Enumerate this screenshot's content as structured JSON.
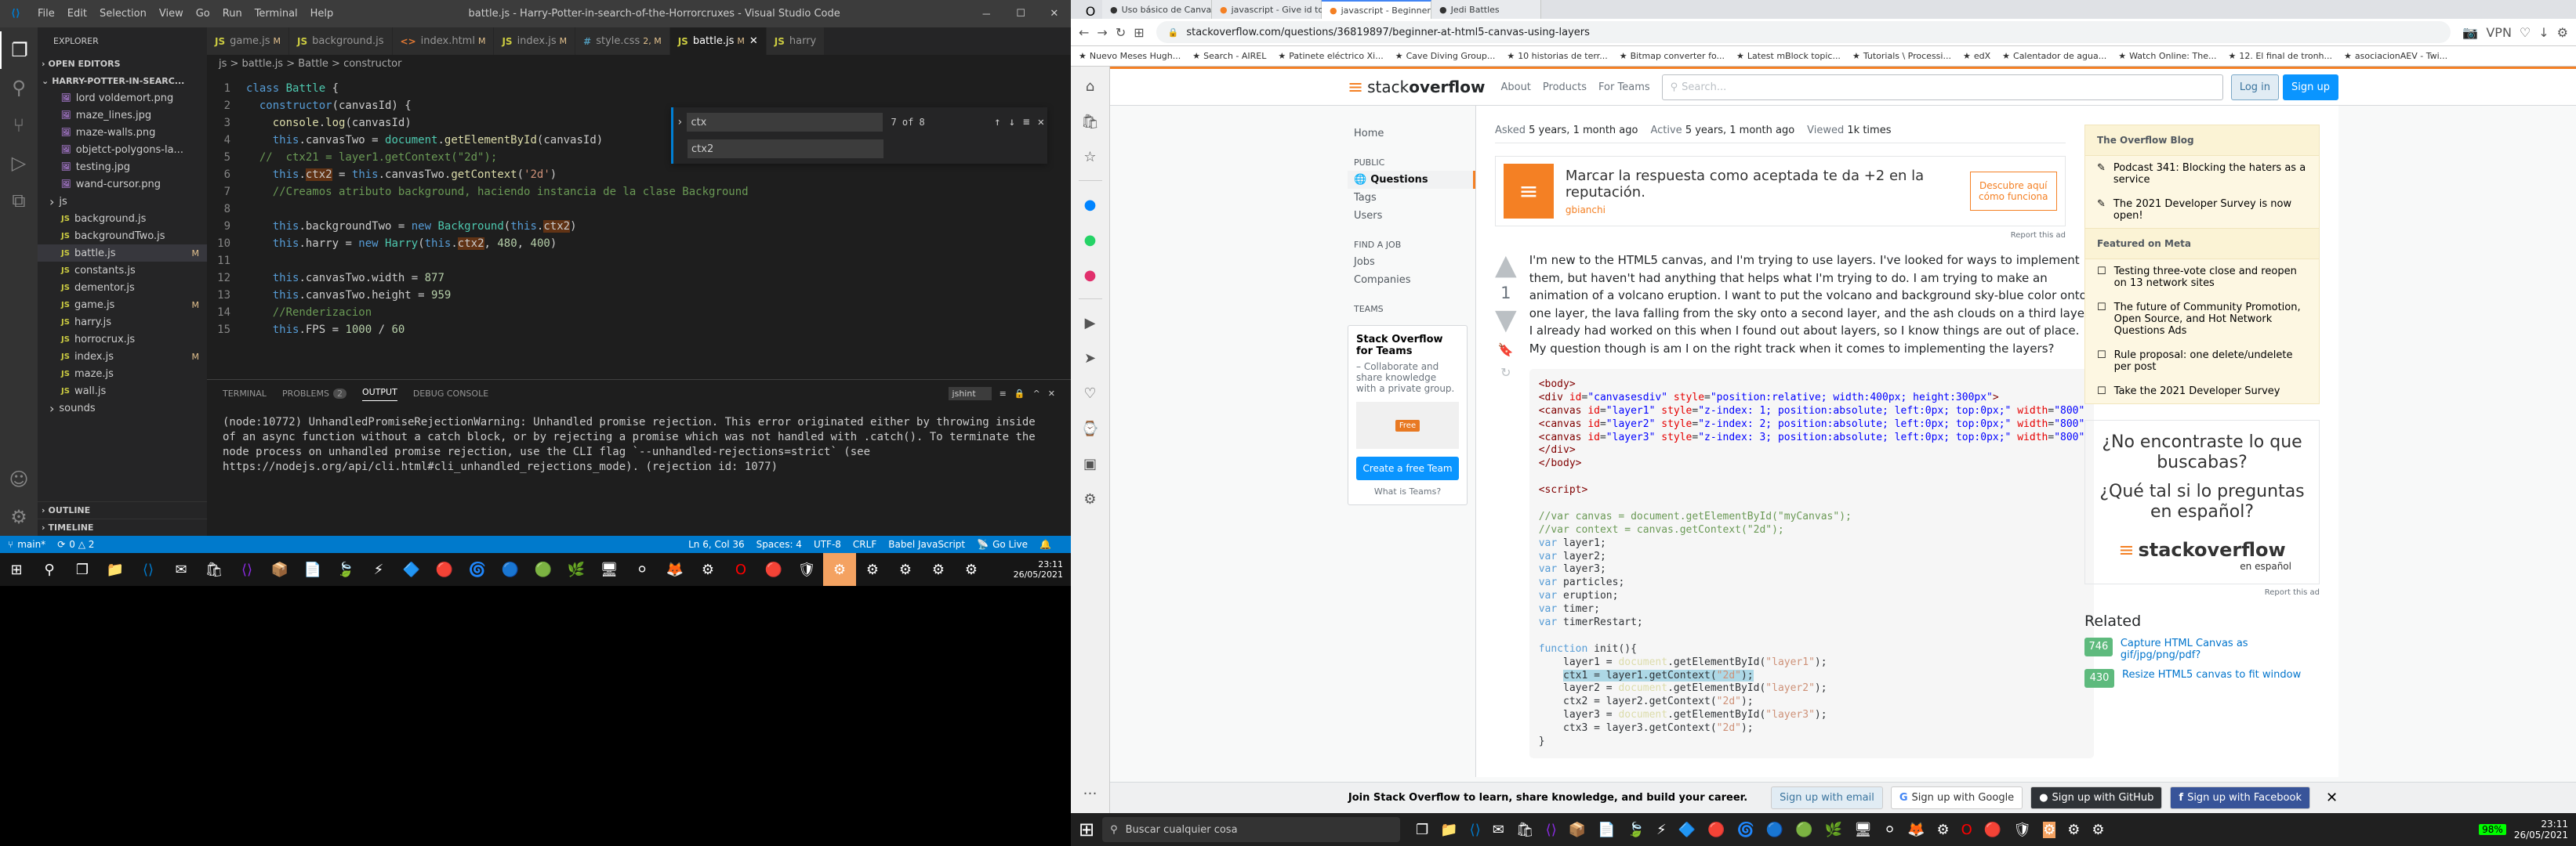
{
  "vscode": {
    "title": "battle.js - Harry-Potter-in-search-of-the-Horrorcruxes - Visual Studio Code",
    "menu": [
      "File",
      "Edit",
      "Selection",
      "View",
      "Go",
      "Run",
      "Terminal",
      "Help"
    ],
    "sidebar": {
      "explorer_label": "EXPLORER",
      "open_editors": "OPEN EDITORS",
      "project_name": "HARRY-POTTER-IN-SEARC...",
      "files": [
        {
          "name": "lord voldemort.png",
          "indent": 2
        },
        {
          "name": "maze_lines.jpg",
          "indent": 2
        },
        {
          "name": "maze-walls.png",
          "indent": 2
        },
        {
          "name": "objetct-polygons-la...",
          "indent": 2
        },
        {
          "name": "testing.jpg",
          "indent": 2
        },
        {
          "name": "wand-cursor.png",
          "indent": 2
        },
        {
          "name": "js",
          "is_folder": true,
          "indent": 1
        },
        {
          "name": "background.js",
          "indent": 2
        },
        {
          "name": "backgroundTwo.js",
          "indent": 2
        },
        {
          "name": "battle.js",
          "status": "M",
          "active": true,
          "indent": 2
        },
        {
          "name": "constants.js",
          "indent": 2
        },
        {
          "name": "dementor.js",
          "indent": 2
        },
        {
          "name": "game.js",
          "status": "M",
          "indent": 2
        },
        {
          "name": "harry.js",
          "indent": 2
        },
        {
          "name": "horrocrux.js",
          "indent": 2
        },
        {
          "name": "index.js",
          "status": "M",
          "indent": 2
        },
        {
          "name": "maze.js",
          "indent": 2
        },
        {
          "name": "wall.js",
          "indent": 2
        },
        {
          "name": "sounds",
          "is_folder": true,
          "indent": 1
        }
      ],
      "outline": "OUTLINE",
      "timeline": "TIMELINE"
    },
    "tabs": [
      {
        "name": "game.js",
        "status": "M",
        "icon": "JS"
      },
      {
        "name": "background.js",
        "icon": "JS"
      },
      {
        "name": "index.html",
        "status": "M",
        "icon": "<>"
      },
      {
        "name": "index.js",
        "status": "M",
        "icon": "JS"
      },
      {
        "name": "style.css",
        "status": "2, M",
        "icon": "#"
      },
      {
        "name": "battle.js",
        "status": "M",
        "active": true,
        "icon": "JS"
      },
      {
        "name": "harry",
        "icon": "JS"
      }
    ],
    "breadcrumbs": "js > battle.js > Battle > constructor",
    "find_widget": {
      "search": "ctx",
      "replace": "ctx2",
      "count": "7 of 8"
    },
    "code_lines": [
      {
        "num": 1,
        "content": "class Battle {"
      },
      {
        "num": 2,
        "content": "  constructor(canvasId) {"
      },
      {
        "num": 3,
        "content": "    console.log(canvasId)"
      },
      {
        "num": 4,
        "content": "    this.canvasTwo = document.getElementById(canvasId)"
      },
      {
        "num": 5,
        "content": "  //  ctx21 = layer1.getContext(\"2d\");"
      },
      {
        "num": 6,
        "content": "    this.ctx2 = this.canvasTwo.getContext('2d')"
      },
      {
        "num": 7,
        "content": "    //Creamos atributo background, haciendo instancia de la clase Background"
      },
      {
        "num": 8,
        "content": ""
      },
      {
        "num": 9,
        "content": "    this.backgroundTwo = new Background(this.ctx2)"
      },
      {
        "num": 10,
        "content": "    this.harry = new Harry(this.ctx2, 480, 400)"
      },
      {
        "num": 11,
        "content": ""
      },
      {
        "num": 12,
        "content": "    this.canvasTwo.width = 877"
      },
      {
        "num": 13,
        "content": "    this.canvasTwo.height = 959"
      },
      {
        "num": 14,
        "content": "    //Renderizacion"
      },
      {
        "num": 15,
        "content": "    this.FPS = 1000 / 60"
      }
    ],
    "panel": {
      "tabs": [
        "TERMINAL",
        "PROBLEMS",
        "OUTPUT",
        "DEBUG CONSOLE"
      ],
      "problems_count": "2",
      "active_tab": "OUTPUT",
      "dropdown": "jshint",
      "content": "(node:10772) UnhandledPromiseRejectionWarning: Unhandled promise rejection. This error originated either by throwing inside of an async function without a catch block, or by rejecting a promise which was not handled with .catch(). To terminate the node process on unhandled promise rejection, use the CLI flag `--unhandled-rejections=strict` (see https://nodejs.org/api/cli.html#cli_unhandled_rejections_mode). (rejection id: 1077)"
    },
    "statusbar": {
      "branch": "main*",
      "sync": "0 △ 2",
      "position": "Ln 6, Col 36",
      "spaces": "Spaces: 4",
      "encoding": "UTF-8",
      "eol": "CRLF",
      "lang": "Babel JavaScript",
      "live": "Go Live"
    },
    "time": "23:11",
    "date": "26/05/2021"
  },
  "browser": {
    "tabs": [
      {
        "title": "Uso básico de Canvas - Re"
      },
      {
        "title": "javascript - Give id to a ca"
      },
      {
        "title": "javascript - Beginner at HT",
        "active": true
      },
      {
        "title": "Jedi Battles"
      }
    ],
    "url": "stackoverflow.com/questions/36819897/beginner-at-html5-canvas-using-layers",
    "bookmarks": [
      "Nuevo Meses Hugh...",
      "Search - AIREL",
      "Patinete eléctrico Xi...",
      "Cave Diving Group...",
      "10 historias de terr...",
      "Bitmap converter fo...",
      "Latest mBlock topic...",
      "Tutorials \\ Processi...",
      "edX",
      "Calentador de agua...",
      "Watch Online: The...",
      "12. El final de tronh...",
      "asociacionAEV - Twi..."
    ],
    "so": {
      "nav": [
        "About",
        "Products",
        "For Teams"
      ],
      "search_placeholder": "Search...",
      "login": "Log in",
      "signup": "Sign up",
      "left_nav": [
        {
          "label": "Home"
        },
        {
          "label": "PUBLIC",
          "header": true
        },
        {
          "label": "Questions",
          "active": true
        },
        {
          "label": "Tags"
        },
        {
          "label": "Users"
        },
        {
          "label": "FIND A JOB",
          "header": true
        },
        {
          "label": "Jobs"
        },
        {
          "label": "Companies"
        },
        {
          "label": "TEAMS",
          "header": true
        }
      ],
      "teams_promo": {
        "title": "Stack Overflow for Teams",
        "text": "– Collaborate and share knowledge with a private group.",
        "btn": "Create a free Team",
        "link": "What is Teams?"
      },
      "question": {
        "asked": "5 years, 1 month ago",
        "active": "5 years, 1 month ago",
        "viewed": "1k times",
        "votes": "1",
        "body": "I'm new to the HTML5 canvas, and I'm trying to use layers. I've looked for ways to implement them, but haven't had anything that helps what I'm trying to do. I am trying to make an animation of a volcano eruption. I want to put the volcano and background sky-blue color onto one layer, the lava falling from the sky onto a second layer, and the ash clouds on a third layer. I already had worked on this when I found out about layers, so I know things are out of place. My question though is am I on the right track when it comes to implementing the layers?",
        "ad": {
          "text": "Marcar la respuesta como aceptada te da +2 en la reputación.",
          "btn": "Descubre aquí cómo funciona",
          "user": "gbianchi",
          "report": "Report this ad"
        }
      },
      "sidebar": {
        "blog_title": "The Overflow Blog",
        "blog_items": [
          "Podcast 341: Blocking the haters as a service",
          "The 2021 Developer Survey is now open!"
        ],
        "meta_title": "Featured on Meta",
        "meta_items": [
          "Testing three-vote close and reopen on 13 network sites",
          "The future of Community Promotion, Open Source, and Hot Network Questions Ads",
          "Rule proposal: one delete/undelete per post",
          "Take the 2021 Developer Survey"
        ],
        "ad": {
          "q1": "¿No encontraste lo que buscabas?",
          "q2": "¿Qué tal si lo preguntas en español?",
          "logo": "stackoverflow",
          "sub": "en español",
          "report": "Report this ad"
        },
        "related_title": "Related",
        "related_items": [
          {
            "score": "746",
            "text": "Capture HTML Canvas as gif/jpg/png/pdf?"
          },
          {
            "score": "430",
            "text": "Resize HTML5 canvas to fit window"
          }
        ]
      },
      "footer_banner": {
        "text": "Join Stack Overflow to learn, share knowledge, and build your career.",
        "email": "Sign up with email",
        "google": "Sign up with Google",
        "github": "Sign up with GitHub",
        "facebook": "Sign up with Facebook"
      }
    },
    "taskbar": {
      "search": "Buscar cualquier cosa",
      "time": "23:11",
      "date": "26/05/2021",
      "battery": "98%"
    }
  }
}
